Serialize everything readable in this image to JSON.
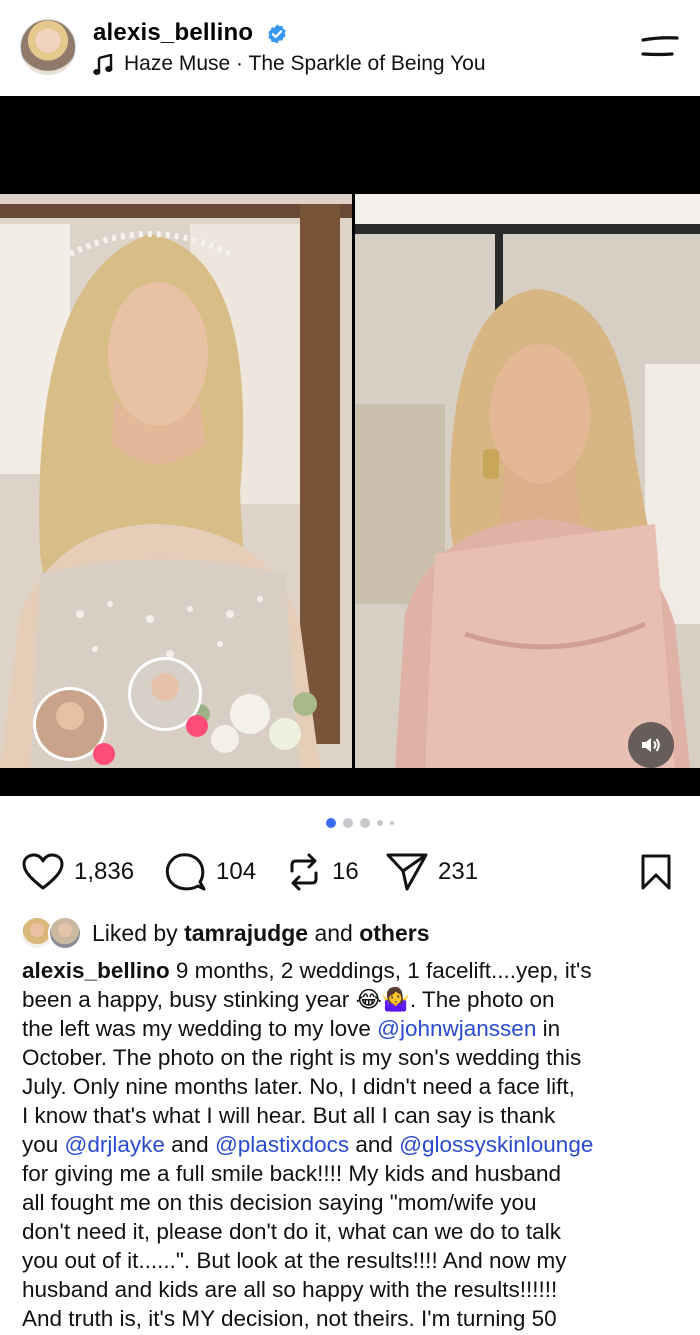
{
  "header": {
    "username": "alexis_bellino",
    "audio": "Haze Muse · The Sparkle of Being You"
  },
  "media": {
    "carousel": {
      "total": 5,
      "active_index": 0
    }
  },
  "actions": {
    "likes": "1,836",
    "comments": "104",
    "reposts": "16",
    "shares": "231"
  },
  "liked_by": {
    "prefix": "Liked by",
    "user": "tamrajudge",
    "and": "and",
    "others": "others"
  },
  "caption": {
    "username": "alexis_bellino",
    "lines": [
      [
        {
          "t": " 9 months, 2 weddings, 1 facelift....yep, it's"
        }
      ],
      [
        {
          "t": "been a happy, busy stinking year 😂🤷‍♀️. The photo on"
        }
      ],
      [
        {
          "t": "the left was my wedding to my love "
        },
        {
          "t": "@johnwjanssen",
          "m": true
        },
        {
          "t": " in"
        }
      ],
      [
        {
          "t": "October. The photo on the right is my son's wedding this"
        }
      ],
      [
        {
          "t": "July. Only nine months later.  No, I didn't need a face lift,"
        }
      ],
      [
        {
          "t": "I know that's what I will hear. But all I can say is thank"
        }
      ],
      [
        {
          "t": "you "
        },
        {
          "t": "@drjlayke",
          "m": true
        },
        {
          "t": " and "
        },
        {
          "t": "@plastixdocs",
          "m": true
        },
        {
          "t": " and "
        },
        {
          "t": "@glossyskinlounge",
          "m": true
        }
      ],
      [
        {
          "t": "for giving me a full smile back!!!! My kids and husband"
        }
      ],
      [
        {
          "t": "all fought me on this decision saying \"mom/wife you"
        }
      ],
      [
        {
          "t": "don't need it, please don't do it, what can we do to talk"
        }
      ],
      [
        {
          "t": "you out of it......\". But look at the results!!!! And now my"
        }
      ],
      [
        {
          "t": "husband and kids are all so happy with the results!!!!!!"
        }
      ],
      [
        {
          "t": "And truth is, it's MY decision, not theirs. I'm turning 50"
        }
      ]
    ]
  },
  "colors": {
    "verified": "#3897f0",
    "mention": "#2a4bd1",
    "active_dot": "#3b6bf5",
    "heart": "#ff3b6b"
  },
  "icons": [
    "verified-badge-icon",
    "music-note-icon",
    "menu-icon",
    "volume-icon",
    "heart-icon",
    "comment-icon",
    "repost-icon",
    "share-icon",
    "bookmark-icon"
  ]
}
